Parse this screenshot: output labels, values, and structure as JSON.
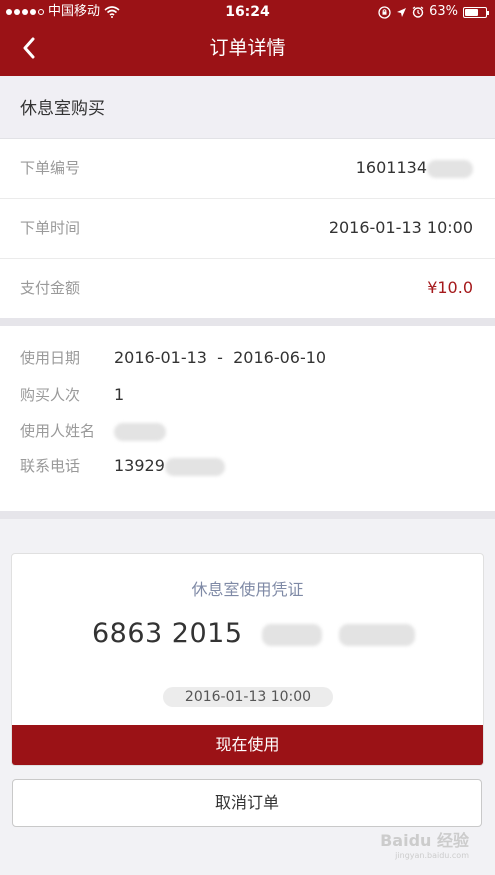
{
  "status_bar": {
    "carrier": "中国移动",
    "time": "16:24",
    "battery": "63%",
    "battery_level": 0.63
  },
  "nav": {
    "title": "订单详情",
    "back_icon": "chevron-left-icon"
  },
  "section_title": "休息室购买",
  "order": {
    "number_label": "下单编号",
    "number_value": "1601134",
    "time_label": "下单时间",
    "time_value": "2016-01-13 10:00",
    "amount_label": "支付金额",
    "amount_value": "¥10.0"
  },
  "details": {
    "date_label": "使用日期",
    "date_value": "2016-01-13  -  2016-06-10",
    "count_label": "购买人次",
    "count_value": "1",
    "name_label": "使用人姓名",
    "phone_label": "联系电话",
    "phone_value": "13929"
  },
  "voucher": {
    "title": "休息室使用凭证",
    "code": "6863 2015",
    "date": "2016-01-13 10:00",
    "use_label": "现在使用"
  },
  "cancel_label": "取消订单",
  "watermark": {
    "text": "Baidu 经验",
    "sub": "jingyan.baidu.com"
  },
  "colors": {
    "brand": "#9b1216",
    "price": "#a51a1c",
    "voucher_title": "#7f8aa6"
  }
}
